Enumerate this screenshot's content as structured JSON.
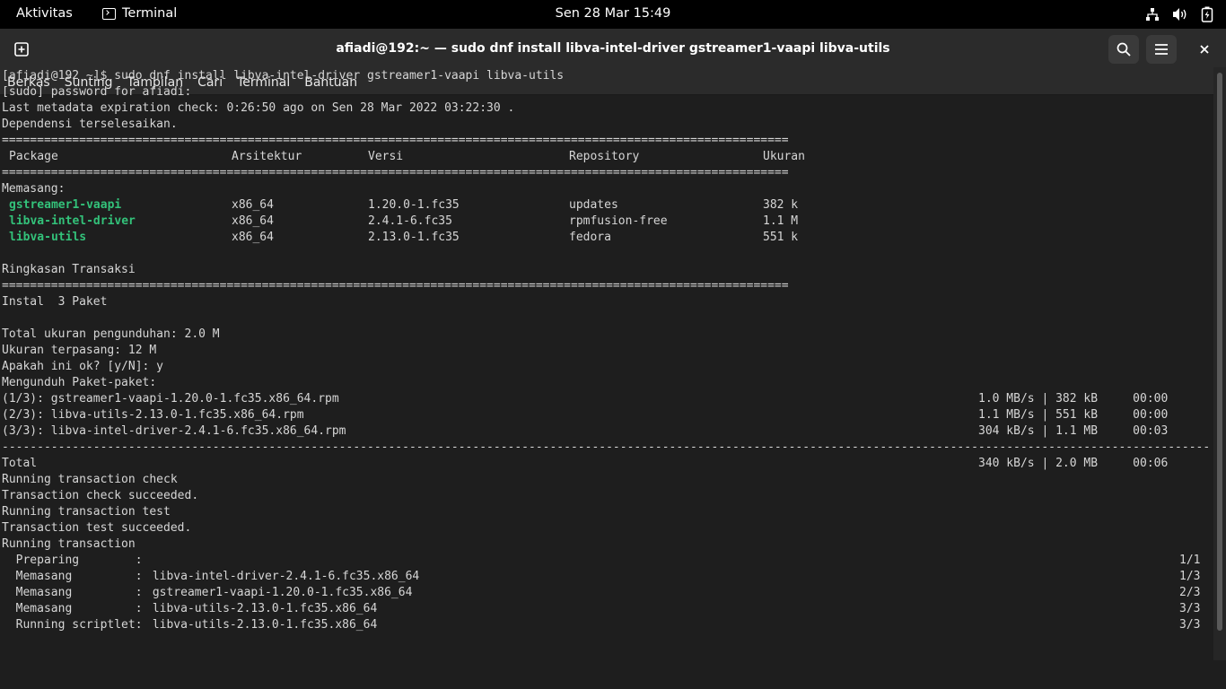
{
  "topbar": {
    "activities": "Aktivitas",
    "app_name": "Terminal",
    "clock": "Sen 28 Mar  15:49"
  },
  "window": {
    "title": "afiadi@192:~ — sudo dnf install libva-intel-driver gstreamer1-vaapi libva-utils"
  },
  "menubar": [
    "Berkas",
    "Sunting",
    "Tampilan",
    "Cari",
    "Terminal",
    "Bantuan"
  ],
  "terminal": {
    "prompt": "[afiadi@192 ~]$ sudo dnf install libva-intel-driver gstreamer1-vaapi libva-utils",
    "sudo": "[sudo] password for afiadi:",
    "metadata": "Last metadata expiration check: 0:26:50 ago on Sen 28 Mar 2022 03:22:30 .",
    "deps": "Dependensi terselesaikan.",
    "separator": "================================================================================================================",
    "headers": [
      "Package",
      "Arsitektur",
      "Versi",
      "Repository",
      "Ukuran"
    ],
    "installing": "Memasang:",
    "packages": [
      {
        "name": "gstreamer1-vaapi",
        "arch": "x86_64",
        "version": "1.20.0-1.fc35",
        "repo": "updates",
        "size": "382 k"
      },
      {
        "name": "libva-intel-driver",
        "arch": "x86_64",
        "version": "2.4.1-6.fc35",
        "repo": "rpmfusion-free",
        "size": "1.1 M"
      },
      {
        "name": "libva-utils",
        "arch": "x86_64",
        "version": "2.13.0-1.fc35",
        "repo": "fedora",
        "size": "551 k"
      }
    ],
    "summary_title": "Ringkasan Transaksi",
    "install_count": "Instal  3 Paket",
    "total_download": "Total ukuran pengunduhan: 2.0 M",
    "installed_size": "Ukuran terpasang: 12 M",
    "confirm": "Apakah ini ok? [y/N]: y",
    "downloading": "Mengunduh Paket-paket:",
    "downloads": [
      {
        "file": "(1/3): gstreamer1-vaapi-1.20.0-1.fc35.x86_64.rpm",
        "stats": "1.0 MB/s | 382 kB     00:00"
      },
      {
        "file": "(2/3): libva-utils-2.13.0-1.fc35.x86_64.rpm",
        "stats": "1.1 MB/s | 551 kB     00:00"
      },
      {
        "file": "(3/3): libva-intel-driver-2.4.1-6.fc35.x86_64.rpm",
        "stats": "304 kB/s | 1.1 MB     00:03"
      }
    ],
    "dash_separator": "--------------------------------------------------------------------------------------------------------------------------------------------------------------------------------------------------------------------------------------------------",
    "total_label": "Total",
    "total_stats": "340 kB/s | 2.0 MB     00:06",
    "tx_lines": [
      "Running transaction check",
      "Transaction check succeeded.",
      "Running transaction test",
      "Transaction test succeeded.",
      "Running transaction"
    ],
    "steps": [
      {
        "label": "  Preparing        :",
        "pkg": "",
        "count": "1/1"
      },
      {
        "label": "  Memasang         :",
        "pkg": " libva-intel-driver-2.4.1-6.fc35.x86_64",
        "count": "1/3"
      },
      {
        "label": "  Memasang         :",
        "pkg": " gstreamer1-vaapi-1.20.0-1.fc35.x86_64",
        "count": "2/3"
      },
      {
        "label": "  Memasang         :",
        "pkg": " libva-utils-2.13.0-1.fc35.x86_64",
        "count": "3/3"
      },
      {
        "label": "  Running scriptlet:",
        "pkg": " libva-utils-2.13.0-1.fc35.x86_64",
        "count": "3/3"
      }
    ]
  },
  "colors": {
    "package_name": "#33c27a",
    "terminal_bg": "#1e1e1e",
    "terminal_fg": "#d6d6d6"
  },
  "icons": [
    "new-tab-icon",
    "terminal-app-icon",
    "network-icon",
    "volume-icon",
    "battery-icon",
    "search-icon",
    "hamburger-menu-icon",
    "close-icon"
  ]
}
